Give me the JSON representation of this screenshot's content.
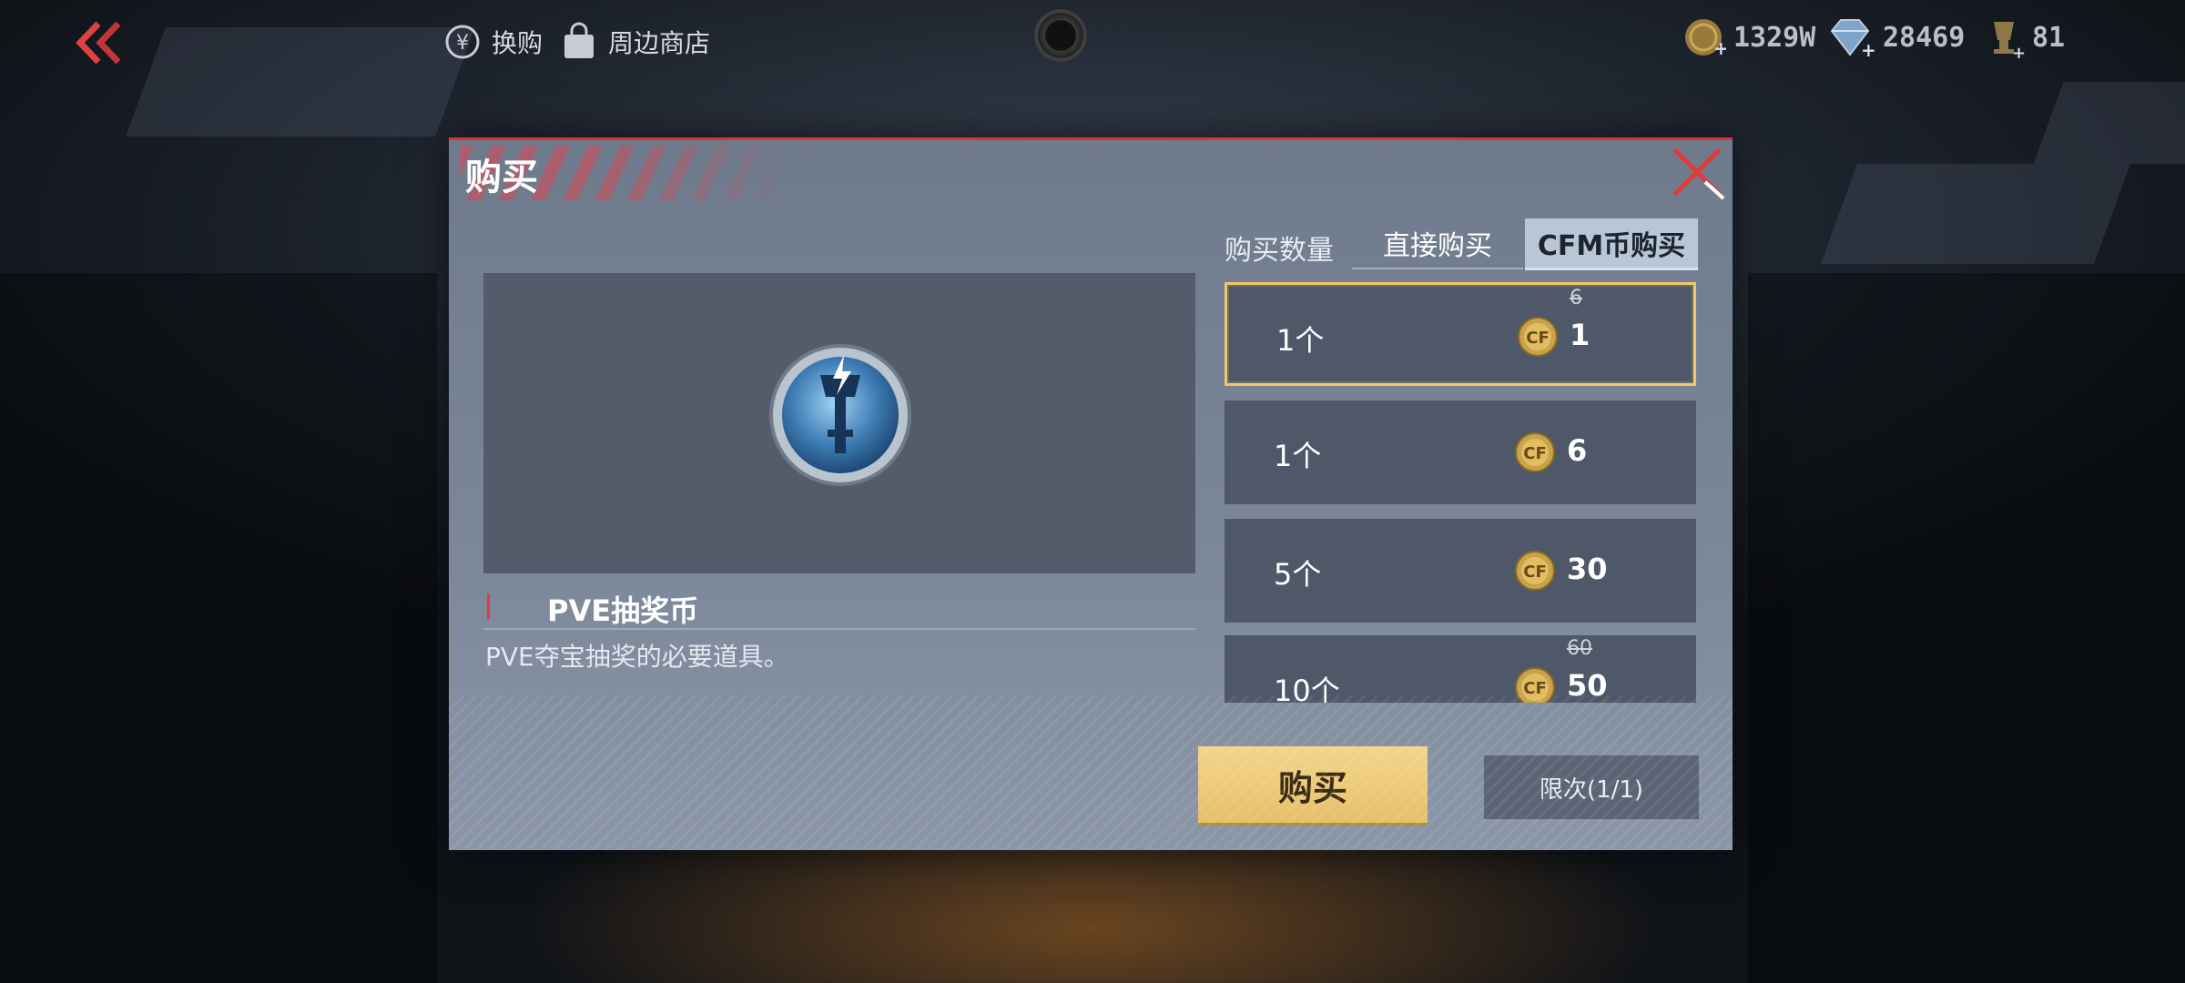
{
  "topbar": {
    "exchange_label": "换购",
    "shop_label": "周边商店",
    "gold": "1329W",
    "diamonds": "28469",
    "tokens": "81"
  },
  "dialog": {
    "title": "购买",
    "item_name": "PVE抽奖币",
    "item_desc": "PVE夺宝抽奖的必要道具。",
    "qty_label": "购买数量",
    "tabs": [
      {
        "label": "直接购买",
        "active": false
      },
      {
        "label": "CFM币购买",
        "active": true
      }
    ],
    "options": [
      {
        "qty": "1个",
        "old_price": "6",
        "price": "1",
        "selected": true
      },
      {
        "qty": "1个",
        "old_price": "",
        "price": "6",
        "selected": false
      },
      {
        "qty": "5个",
        "old_price": "",
        "price": "30",
        "selected": false
      },
      {
        "qty": "10个",
        "old_price": "60",
        "price": "50",
        "selected": false
      }
    ],
    "buy_label": "购买",
    "limit_label": "限次(1/1)"
  },
  "colors": {
    "accent_red": "#d8333b",
    "gold": "#f0c867",
    "coin": "#c9a24a"
  }
}
